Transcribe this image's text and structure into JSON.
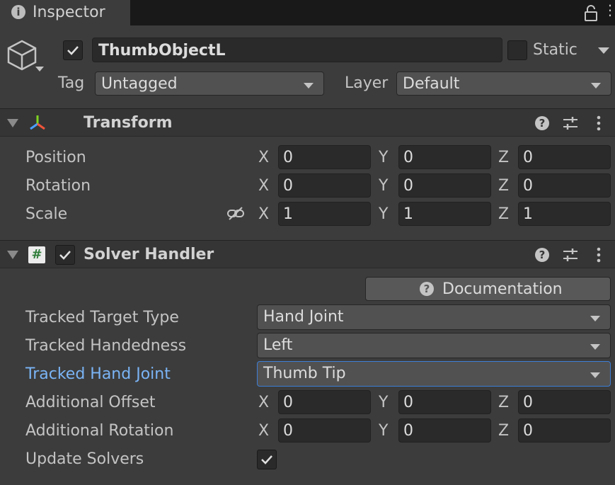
{
  "tab": {
    "title": "Inspector"
  },
  "header": {
    "active": true,
    "name": "ThumbObjectL",
    "static_label": "Static",
    "static": false,
    "tag_label": "Tag",
    "tag_value": "Untagged",
    "layer_label": "Layer",
    "layer_value": "Default"
  },
  "transform": {
    "title": "Transform",
    "rows": [
      {
        "label": "Position",
        "x": "0",
        "y": "0",
        "z": "0"
      },
      {
        "label": "Rotation",
        "x": "0",
        "y": "0",
        "z": "0"
      },
      {
        "label": "Scale",
        "x": "1",
        "y": "1",
        "z": "1"
      }
    ]
  },
  "axes": {
    "x": "X",
    "y": "Y",
    "z": "Z"
  },
  "solver": {
    "title": "Solver Handler",
    "enabled": true,
    "doc_label": "Documentation",
    "tracked_target_type": {
      "label": "Tracked Target Type",
      "value": "Hand Joint"
    },
    "tracked_handedness": {
      "label": "Tracked Handedness",
      "value": "Left"
    },
    "tracked_hand_joint": {
      "label": "Tracked Hand Joint",
      "value": "Thumb Tip"
    },
    "additional_offset": {
      "label": "Additional Offset",
      "x": "0",
      "y": "0",
      "z": "0"
    },
    "additional_rotation": {
      "label": "Additional Rotation",
      "x": "0",
      "y": "0",
      "z": "0"
    },
    "update_solvers": {
      "label": "Update Solvers",
      "checked": true
    }
  },
  "colors": {
    "background": "#3c3c3c",
    "field": "#2a2a2a",
    "focused_border": "#3d7ed6",
    "focused_label": "#7ab4f5"
  }
}
